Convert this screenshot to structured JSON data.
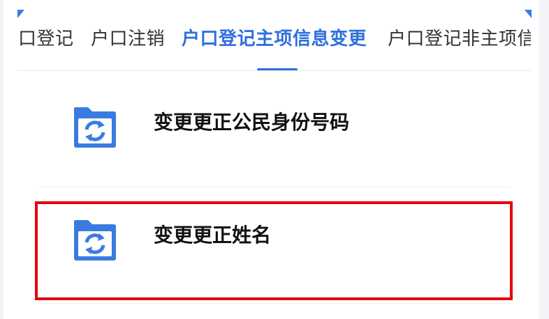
{
  "tabs": [
    {
      "label": "口登记",
      "active": false
    },
    {
      "label": "户口注销",
      "active": false
    },
    {
      "label": "户口登记主项信息变更",
      "active": true
    },
    {
      "label": "户口登记非主项信",
      "active": false
    }
  ],
  "items": [
    {
      "label": "变更更正公民身份号码",
      "icon": "folder-refresh-icon"
    },
    {
      "label": "变更更正姓名",
      "icon": "folder-refresh-icon",
      "highlighted": true
    }
  ],
  "colors": {
    "accent": "#2f6fde",
    "highlight": "#e8000b",
    "icon_blue": "#3a7be0"
  }
}
